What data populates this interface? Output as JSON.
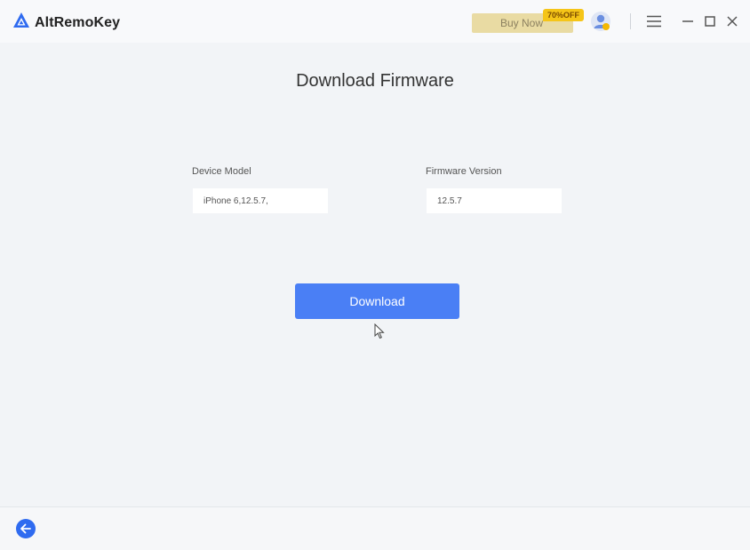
{
  "app": {
    "name": "AltRemoKey",
    "logo_icon": "altremokey-logo-icon"
  },
  "titlebar": {
    "buy_now_label": "Buy Now",
    "discount_badge": "70%OFF",
    "avatar_icon": "user-avatar-icon",
    "menu_icon": "hamburger-menu-icon",
    "minimize_icon": "minimize-icon",
    "maximize_icon": "maximize-icon",
    "close_icon": "close-icon"
  },
  "main": {
    "title": "Download Firmware",
    "device_model": {
      "label": "Device Model",
      "value": "iPhone 6,12.5.7,"
    },
    "firmware_version": {
      "label": "Firmware Version",
      "value": "12.5.7"
    },
    "download_label": "Download"
  },
  "footer": {
    "back_icon": "back-arrow-icon"
  },
  "colors": {
    "accent": "#4a7ff5",
    "back_button": "#2f6bf0",
    "buy_now_bg": "#e9dba3",
    "badge": "#f5c518",
    "background": "#f2f4f7"
  }
}
